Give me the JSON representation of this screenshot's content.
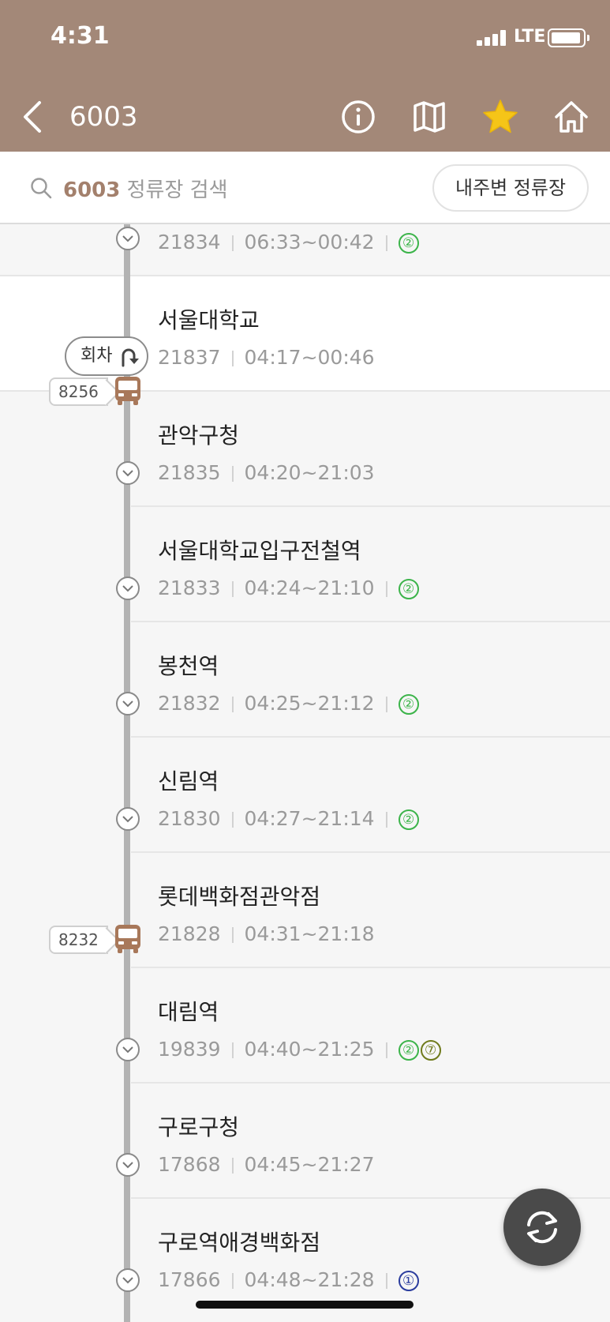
{
  "status": {
    "time": "4:31",
    "network": "LTE"
  },
  "header": {
    "route_number": "6003",
    "icons": [
      "back-icon",
      "info-icon",
      "map-icon",
      "star-icon",
      "home-icon"
    ],
    "star_color": "#f5c518",
    "background": "#a38878"
  },
  "search": {
    "route_number": "6003",
    "placeholder": "정류장 검색",
    "nearby_label": "내주변 정류장"
  },
  "turnaround_label": "회차",
  "partial_stop": {
    "id": "21834",
    "hours": "06:33~00:42",
    "lines": [
      "②"
    ]
  },
  "stops": [
    {
      "name": "서울대학교",
      "id": "21837",
      "hours": "04:17~00:46",
      "lines": []
    },
    {
      "name": "관악구청",
      "id": "21835",
      "hours": "04:20~21:03",
      "lines": []
    },
    {
      "name": "서울대학교입구전철역",
      "id": "21833",
      "hours": "04:24~21:10",
      "lines": [
        "②"
      ]
    },
    {
      "name": "봉천역",
      "id": "21832",
      "hours": "04:25~21:12",
      "lines": [
        "②"
      ]
    },
    {
      "name": "신림역",
      "id": "21830",
      "hours": "04:27~21:14",
      "lines": [
        "②"
      ]
    },
    {
      "name": "롯데백화점관악점",
      "id": "21828",
      "hours": "04:31~21:18",
      "lines": []
    },
    {
      "name": "대림역",
      "id": "19839",
      "hours": "04:40~21:25",
      "lines": [
        "②",
        "⑦"
      ]
    },
    {
      "name": "구로구청",
      "id": "17868",
      "hours": "04:45~21:27",
      "lines": []
    },
    {
      "name": "구로역애경백화점",
      "id": "17866",
      "hours": "04:48~21:28",
      "lines": [
        "①"
      ]
    }
  ],
  "buses": [
    {
      "plate": "8256",
      "at_stop": "서울대학교"
    },
    {
      "plate": "8232",
      "at_stop": "롯데백화점관악점"
    }
  ],
  "line_colors": {
    "①": "#2b3d9e",
    "②": "#3cb44a",
    "⑦": "#6f7a1b"
  }
}
